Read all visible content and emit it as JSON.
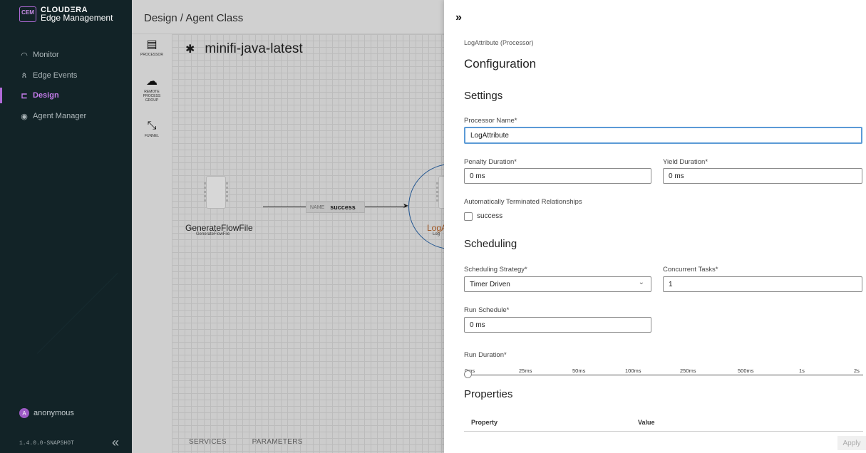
{
  "sidebar": {
    "logo_badge": "CEM",
    "brand": "CLOUDΞRA",
    "product": "Edge Management",
    "items": [
      {
        "label": "Monitor",
        "icon": "gauge-icon"
      },
      {
        "label": "Edge Events",
        "icon": "person-icon"
      },
      {
        "label": "Design",
        "icon": "design-icon",
        "active": true
      },
      {
        "label": "Agent Manager",
        "icon": "agent-icon"
      }
    ],
    "user": {
      "initial": "A",
      "name": "anonymous"
    },
    "version": "1.4.0.0-SNAPSHOT",
    "collapse_icon": "double-chevron-left-icon"
  },
  "canvas": {
    "breadcrumb": "Design / Agent Class",
    "flow_name": "minifi-java-latest",
    "flow_icon": "star-icon",
    "palette": [
      {
        "label": "PROCESSOR",
        "icon": "processor-icon"
      },
      {
        "label": "REMOTE PROCESS GROUP",
        "icon": "cloud-icon"
      },
      {
        "label": "FUNNEL",
        "icon": "funnel-icon"
      }
    ],
    "nodes": [
      {
        "name": "GenerateFlowFile",
        "type": "GenerateFlowFile"
      },
      {
        "name": "LogA",
        "type": "Log"
      }
    ],
    "connection": {
      "key": "NAME",
      "value": "success"
    },
    "tabs": [
      "SERVICES",
      "PARAMETERS"
    ]
  },
  "panel": {
    "close_icon": "double-chevron-right-icon",
    "processor_type": "LogAttribute (Processor)",
    "title": "Configuration",
    "settings": {
      "heading": "Settings",
      "processor_name_label": "Processor Name*",
      "processor_name": "LogAttribute",
      "penalty_label": "Penalty Duration*",
      "penalty": "0 ms",
      "yield_label": "Yield Duration*",
      "yield": "0 ms",
      "auto_term_label": "Automatically Terminated Relationships",
      "auto_term_option": "success"
    },
    "scheduling": {
      "heading": "Scheduling",
      "strategy_label": "Scheduling Strategy*",
      "strategy": "Timer Driven",
      "concurrent_label": "Concurrent Tasks*",
      "concurrent": "1",
      "run_schedule_label": "Run Schedule*",
      "run_schedule": "0 ms",
      "run_duration_label": "Run Duration*",
      "run_duration_ticks": [
        "0ms",
        "25ms",
        "50ms",
        "100ms",
        "250ms",
        "500ms",
        "1s",
        "2s"
      ],
      "run_duration_value": "0ms"
    },
    "properties": {
      "heading": "Properties",
      "col_property": "Property",
      "col_value": "Value"
    },
    "apply_label": "Apply"
  }
}
